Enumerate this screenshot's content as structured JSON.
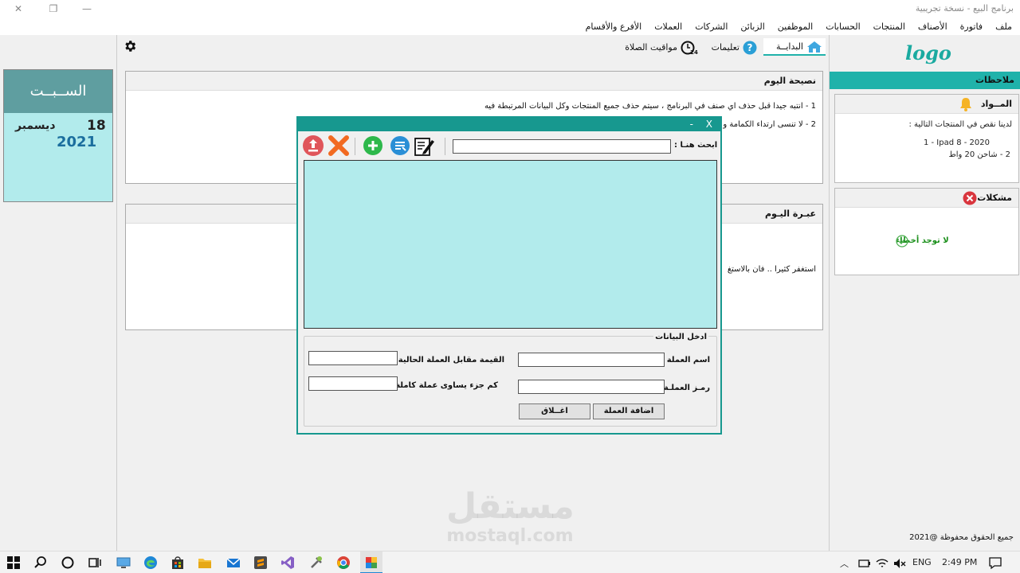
{
  "window": {
    "title": "برنامج البيع - نسخة تجريبية"
  },
  "menu": [
    "ملف",
    "فاتورة",
    "الأصناف",
    "المنتجات",
    "الحسابات",
    "الموظفين",
    "الزبائن",
    "الشركات",
    "العملات",
    "الأفرع والأقسام"
  ],
  "tabs": {
    "home": "البدايــة",
    "help": "تعليمات",
    "prayer": "مواقيت الصلاة"
  },
  "logo": "logo",
  "notes": {
    "header": "ملاحظات",
    "materials": {
      "title": "المــواد",
      "intro": "لدينا نقص في المنتجات التالية :",
      "items": [
        "1 - Ipad 8 - 2020",
        "2 - شاحن 20 واط"
      ]
    },
    "problems": {
      "title": "مشكلات",
      "status": "لا توجد أخطاء"
    }
  },
  "copyright": "جميع الحقوق محفوظة @2021",
  "date": {
    "day_name": "الســبــت",
    "day": "18",
    "month": "ديسمبر",
    "year": "2021"
  },
  "tip": {
    "title": "نصيحة اليوم",
    "lines": [
      "1 - انتبه جيدا قبل حذف اي صنف في البرنامج ، سيتم حذف جميع المنتجات وكل البيانات المرتبطة فيه",
      "2 - لا تنسى ارتداء الكمامة و"
    ]
  },
  "lesson": {
    "title": "عبـرة اليـوم",
    "text": "استغفر كثيرا .. فان بالاستغ"
  },
  "dialog": {
    "close": "X",
    "minimize": "-",
    "search_label": "ابحث هنـا :",
    "search_value": "",
    "section_title": "ادخل البيانات",
    "fields": {
      "currency_name": "اسم العملة",
      "currency_symbol": "رمـز العملـة :",
      "current_value": "القيمة مقابل العملة الحالية :",
      "fraction": "كم جزء يساوى عملة كاملة :"
    },
    "values": {
      "currency_name": "",
      "currency_symbol": "",
      "current_value": "",
      "fraction": ""
    },
    "buttons": {
      "add": "اضافة العملة",
      "close": "اغــلاق"
    }
  },
  "watermark": {
    "arabic": "مستقل",
    "latin": "mostaql.com"
  },
  "taskbar": {
    "lang": "ENG",
    "time": "2:49 PM"
  },
  "colors": {
    "accent": "#20b2aa",
    "dialog_border": "#17988f",
    "grid_bg": "#b2ebec",
    "day_header": "#5f9ea0"
  }
}
